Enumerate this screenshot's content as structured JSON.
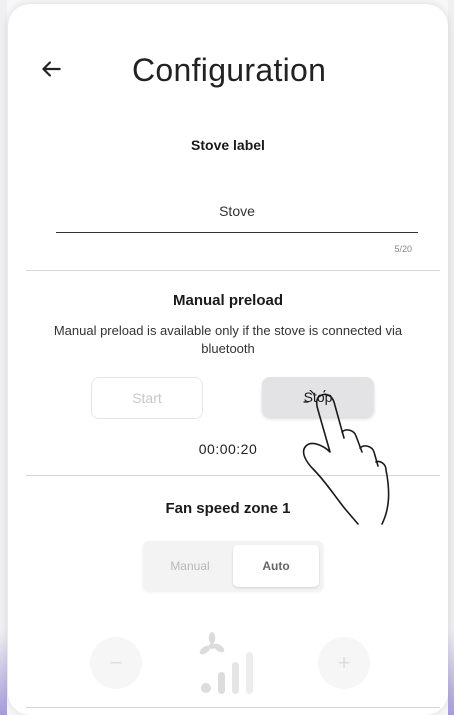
{
  "header": {
    "title": "Configuration",
    "back_icon": "arrow-left-icon"
  },
  "stove_label": {
    "heading": "Stove label",
    "value": "Stove",
    "counter": "5/20"
  },
  "manual_preload": {
    "heading": "Manual preload",
    "hint": "Manual preload is available only if the stove is connected via bluetooth",
    "start_label": "Start",
    "stop_label": "Stop",
    "timer": "00:00:20"
  },
  "fan_speed": {
    "heading": "Fan speed zone 1",
    "modes": [
      "Manual",
      "Auto"
    ],
    "selected_mode": "Auto",
    "minus_label": "−",
    "plus_label": "+",
    "icons": [
      "fan-icon",
      "signal-bars-icon",
      "minus-icon",
      "plus-icon"
    ]
  },
  "colors": {
    "accent_edge": "#a69bd9",
    "divider": "#d6d6d6"
  }
}
